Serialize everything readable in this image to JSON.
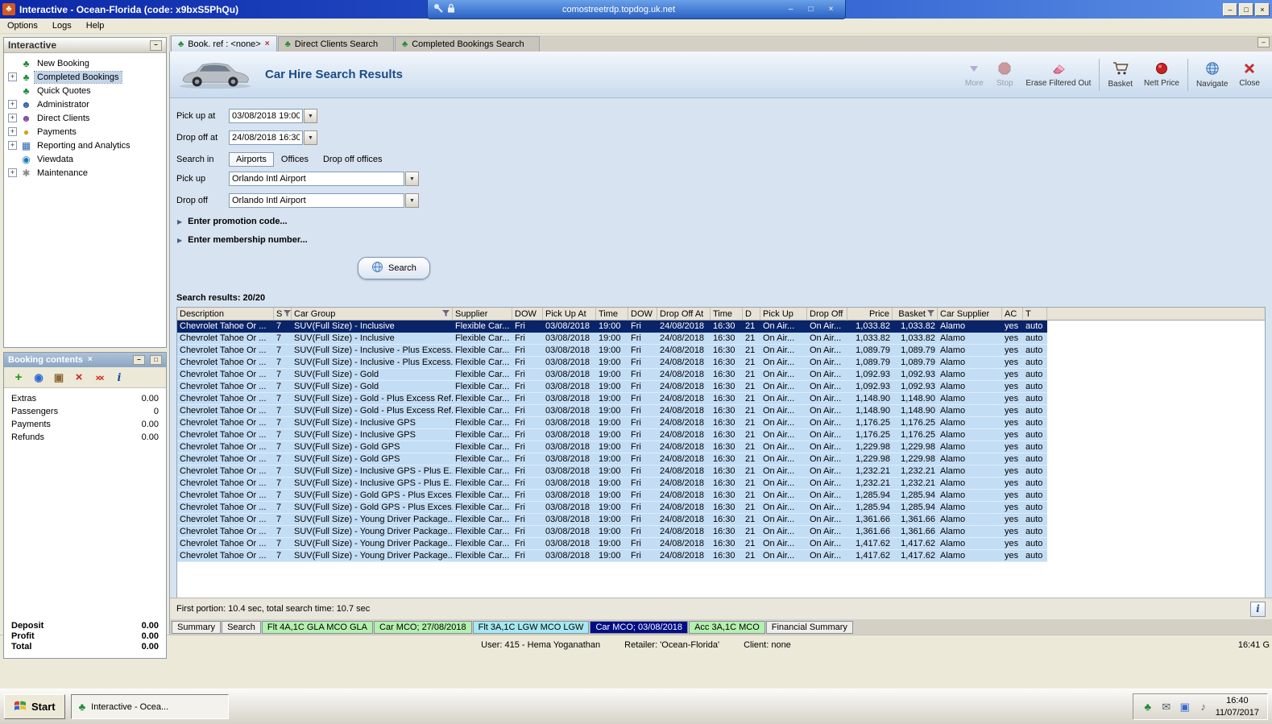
{
  "window": {
    "title": "Interactive - Ocean-Florida (code: x9bxS5PhQu)"
  },
  "rdp": {
    "host": "comostreetrdp.topdog.uk.net"
  },
  "glyphs": {
    "minimize": "–",
    "restore": "□",
    "close": "×",
    "dropdown": "▼",
    "plus": "+",
    "arrow": "▶",
    "info": "i",
    "palm": "♣"
  },
  "menu": {
    "items": [
      {
        "label": "Options"
      },
      {
        "label": "Logs"
      },
      {
        "label": "Help"
      }
    ]
  },
  "sidebar": {
    "title": "Interactive",
    "items": [
      {
        "label": "New Booking",
        "icon": "palm-tree-icon",
        "icon_cls": "palm",
        "expander": false,
        "cls": ""
      },
      {
        "label": "Completed Bookings",
        "icon": "palm-tree-icon",
        "icon_cls": "palm",
        "expander": true,
        "cls": "selected"
      },
      {
        "label": "Quick Quotes",
        "icon": "palm-tree-icon",
        "icon_cls": "palm",
        "expander": false,
        "cls": ""
      },
      {
        "label": "Administrator",
        "icon": "administrator-icon",
        "icon_cls": "admin",
        "expander": true,
        "cls": ""
      },
      {
        "label": "Direct Clients",
        "icon": "clients-icon",
        "icon_cls": "clients",
        "expander": true,
        "cls": ""
      },
      {
        "label": "Payments",
        "icon": "payments-icon",
        "icon_cls": "payments",
        "expander": true,
        "cls": ""
      },
      {
        "label": "Reporting and Analytics",
        "icon": "reporting-icon",
        "icon_cls": "reporting",
        "expander": true,
        "cls": ""
      },
      {
        "label": "Viewdata",
        "icon": "viewdata-icon",
        "icon_cls": "viewdata",
        "expander": false,
        "cls": ""
      },
      {
        "label": "Maintenance",
        "icon": "maintenance-icon",
        "icon_cls": "maintenance",
        "expander": true,
        "cls": ""
      }
    ]
  },
  "booking_contents": {
    "title": "Booking contents",
    "rows": [
      {
        "label": "Extras",
        "value": "0.00"
      },
      {
        "label": "Passengers",
        "value": "0"
      },
      {
        "label": "Payments",
        "value": "0.00"
      },
      {
        "label": "Refunds",
        "value": "0.00"
      }
    ],
    "totals": [
      {
        "label": "Deposit",
        "value": "0.00"
      },
      {
        "label": "Profit",
        "value": "0.00"
      },
      {
        "label": "Total",
        "value": "0.00"
      }
    ]
  },
  "tabs": [
    {
      "label": "Book. ref : <none>",
      "cls": "active",
      "closable": true
    },
    {
      "label": "Direct Clients Search",
      "cls": "",
      "closable": false
    },
    {
      "label": "Completed Bookings Search",
      "cls": "",
      "closable": false
    }
  ],
  "header": {
    "title": "Car Hire Search Results",
    "tools": [
      {
        "label": "More"
      },
      {
        "label": "Stop"
      },
      {
        "label": "Erase Filtered Out"
      },
      {
        "label": "Basket"
      },
      {
        "label": "Nett Price"
      },
      {
        "label": "Navigate"
      },
      {
        "label": "Close"
      }
    ]
  },
  "form": {
    "pickup_at_label": "Pick up at",
    "pickup_at_value": "03/08/2018 19:00",
    "dropoff_at_label": "Drop off at",
    "dropoff_at_value": "24/08/2018 16:30",
    "search_in_label": "Search in",
    "search_in_tabs": [
      {
        "label": "Airports",
        "cls": "selected"
      },
      {
        "label": "Offices",
        "cls": ""
      },
      {
        "label": "Drop off offices",
        "cls": ""
      }
    ],
    "pickup_label": "Pick up",
    "pickup_value": "Orlando Intl Airport",
    "dropoff_label": "Drop off",
    "dropoff_value": "Orlando Intl Airport",
    "promo_expander": "Enter promotion code...",
    "membership_expander": "Enter membership number...",
    "search_button": "Search"
  },
  "results": {
    "summary": "Search results: 20/20",
    "status": "First portion: 10.4 sec, total search time: 10.7 sec",
    "columns": [
      "Description",
      "S",
      "Car Group",
      "Supplier",
      "DOW",
      "Pick Up At",
      "Time",
      "DOW",
      "Drop Off At",
      "Time",
      "D",
      "Pick Up",
      "Drop Off",
      "Price",
      "Basket",
      "Car Supplier",
      "AC",
      "T"
    ],
    "rows": [
      {
        "desc": "Chevrolet Tahoe Or ...",
        "s": "7",
        "group": "SUV(Full Size) - Inclusive",
        "sup": "Flexible Car...",
        "dow1": "Fri",
        "pu_date": "03/08/2018",
        "pu_time": "19:00",
        "dow2": "Fri",
        "do_date": "24/08/2018",
        "do_time": "16:30",
        "d": "21",
        "pu_loc": "On Air...",
        "do_loc": "On Air...",
        "price": "1,033.82",
        "basket": "1,033.82",
        "car_sup": "Alamo",
        "ac": "yes",
        "t": "auto",
        "cls": "selected"
      },
      {
        "desc": "Chevrolet Tahoe Or ...",
        "s": "7",
        "group": "SUV(Full Size) - Inclusive",
        "sup": "Flexible Car...",
        "dow1": "Fri",
        "pu_date": "03/08/2018",
        "pu_time": "19:00",
        "dow2": "Fri",
        "do_date": "24/08/2018",
        "do_time": "16:30",
        "d": "21",
        "pu_loc": "On Air...",
        "do_loc": "On Air...",
        "price": "1,033.82",
        "basket": "1,033.82",
        "car_sup": "Alamo",
        "ac": "yes",
        "t": "auto",
        "cls": ""
      },
      {
        "desc": "Chevrolet Tahoe Or ...",
        "s": "7",
        "group": "SUV(Full Size) - Inclusive - Plus Excess...",
        "sup": "Flexible Car...",
        "dow1": "Fri",
        "pu_date": "03/08/2018",
        "pu_time": "19:00",
        "dow2": "Fri",
        "do_date": "24/08/2018",
        "do_time": "16:30",
        "d": "21",
        "pu_loc": "On Air...",
        "do_loc": "On Air...",
        "price": "1,089.79",
        "basket": "1,089.79",
        "car_sup": "Alamo",
        "ac": "yes",
        "t": "auto",
        "cls": ""
      },
      {
        "desc": "Chevrolet Tahoe Or ...",
        "s": "7",
        "group": "SUV(Full Size) - Inclusive - Plus Excess...",
        "sup": "Flexible Car...",
        "dow1": "Fri",
        "pu_date": "03/08/2018",
        "pu_time": "19:00",
        "dow2": "Fri",
        "do_date": "24/08/2018",
        "do_time": "16:30",
        "d": "21",
        "pu_loc": "On Air...",
        "do_loc": "On Air...",
        "price": "1,089.79",
        "basket": "1,089.79",
        "car_sup": "Alamo",
        "ac": "yes",
        "t": "auto",
        "cls": ""
      },
      {
        "desc": "Chevrolet Tahoe Or ...",
        "s": "7",
        "group": "SUV(Full Size) - Gold",
        "sup": "Flexible Car...",
        "dow1": "Fri",
        "pu_date": "03/08/2018",
        "pu_time": "19:00",
        "dow2": "Fri",
        "do_date": "24/08/2018",
        "do_time": "16:30",
        "d": "21",
        "pu_loc": "On Air...",
        "do_loc": "On Air...",
        "price": "1,092.93",
        "basket": "1,092.93",
        "car_sup": "Alamo",
        "ac": "yes",
        "t": "auto",
        "cls": ""
      },
      {
        "desc": "Chevrolet Tahoe Or ...",
        "s": "7",
        "group": "SUV(Full Size) - Gold",
        "sup": "Flexible Car...",
        "dow1": "Fri",
        "pu_date": "03/08/2018",
        "pu_time": "19:00",
        "dow2": "Fri",
        "do_date": "24/08/2018",
        "do_time": "16:30",
        "d": "21",
        "pu_loc": "On Air...",
        "do_loc": "On Air...",
        "price": "1,092.93",
        "basket": "1,092.93",
        "car_sup": "Alamo",
        "ac": "yes",
        "t": "auto",
        "cls": ""
      },
      {
        "desc": "Chevrolet Tahoe Or ...",
        "s": "7",
        "group": "SUV(Full Size) - Gold - Plus Excess Ref...",
        "sup": "Flexible Car...",
        "dow1": "Fri",
        "pu_date": "03/08/2018",
        "pu_time": "19:00",
        "dow2": "Fri",
        "do_date": "24/08/2018",
        "do_time": "16:30",
        "d": "21",
        "pu_loc": "On Air...",
        "do_loc": "On Air...",
        "price": "1,148.90",
        "basket": "1,148.90",
        "car_sup": "Alamo",
        "ac": "yes",
        "t": "auto",
        "cls": ""
      },
      {
        "desc": "Chevrolet Tahoe Or ...",
        "s": "7",
        "group": "SUV(Full Size) - Gold - Plus Excess Ref...",
        "sup": "Flexible Car...",
        "dow1": "Fri",
        "pu_date": "03/08/2018",
        "pu_time": "19:00",
        "dow2": "Fri",
        "do_date": "24/08/2018",
        "do_time": "16:30",
        "d": "21",
        "pu_loc": "On Air...",
        "do_loc": "On Air...",
        "price": "1,148.90",
        "basket": "1,148.90",
        "car_sup": "Alamo",
        "ac": "yes",
        "t": "auto",
        "cls": ""
      },
      {
        "desc": "Chevrolet Tahoe Or ...",
        "s": "7",
        "group": "SUV(Full Size) - Inclusive GPS",
        "sup": "Flexible Car...",
        "dow1": "Fri",
        "pu_date": "03/08/2018",
        "pu_time": "19:00",
        "dow2": "Fri",
        "do_date": "24/08/2018",
        "do_time": "16:30",
        "d": "21",
        "pu_loc": "On Air...",
        "do_loc": "On Air...",
        "price": "1,176.25",
        "basket": "1,176.25",
        "car_sup": "Alamo",
        "ac": "yes",
        "t": "auto",
        "cls": ""
      },
      {
        "desc": "Chevrolet Tahoe Or ...",
        "s": "7",
        "group": "SUV(Full Size) - Inclusive GPS",
        "sup": "Flexible Car...",
        "dow1": "Fri",
        "pu_date": "03/08/2018",
        "pu_time": "19:00",
        "dow2": "Fri",
        "do_date": "24/08/2018",
        "do_time": "16:30",
        "d": "21",
        "pu_loc": "On Air...",
        "do_loc": "On Air...",
        "price": "1,176.25",
        "basket": "1,176.25",
        "car_sup": "Alamo",
        "ac": "yes",
        "t": "auto",
        "cls": ""
      },
      {
        "desc": "Chevrolet Tahoe Or ...",
        "s": "7",
        "group": "SUV(Full Size) - Gold GPS",
        "sup": "Flexible Car...",
        "dow1": "Fri",
        "pu_date": "03/08/2018",
        "pu_time": "19:00",
        "dow2": "Fri",
        "do_date": "24/08/2018",
        "do_time": "16:30",
        "d": "21",
        "pu_loc": "On Air...",
        "do_loc": "On Air...",
        "price": "1,229.98",
        "basket": "1,229.98",
        "car_sup": "Alamo",
        "ac": "yes",
        "t": "auto",
        "cls": ""
      },
      {
        "desc": "Chevrolet Tahoe Or ...",
        "s": "7",
        "group": "SUV(Full Size) - Gold GPS",
        "sup": "Flexible Car...",
        "dow1": "Fri",
        "pu_date": "03/08/2018",
        "pu_time": "19:00",
        "dow2": "Fri",
        "do_date": "24/08/2018",
        "do_time": "16:30",
        "d": "21",
        "pu_loc": "On Air...",
        "do_loc": "On Air...",
        "price": "1,229.98",
        "basket": "1,229.98",
        "car_sup": "Alamo",
        "ac": "yes",
        "t": "auto",
        "cls": ""
      },
      {
        "desc": "Chevrolet Tahoe Or ...",
        "s": "7",
        "group": "SUV(Full Size) - Inclusive GPS - Plus E...",
        "sup": "Flexible Car...",
        "dow1": "Fri",
        "pu_date": "03/08/2018",
        "pu_time": "19:00",
        "dow2": "Fri",
        "do_date": "24/08/2018",
        "do_time": "16:30",
        "d": "21",
        "pu_loc": "On Air...",
        "do_loc": "On Air...",
        "price": "1,232.21",
        "basket": "1,232.21",
        "car_sup": "Alamo",
        "ac": "yes",
        "t": "auto",
        "cls": ""
      },
      {
        "desc": "Chevrolet Tahoe Or ...",
        "s": "7",
        "group": "SUV(Full Size) - Inclusive GPS - Plus E...",
        "sup": "Flexible Car...",
        "dow1": "Fri",
        "pu_date": "03/08/2018",
        "pu_time": "19:00",
        "dow2": "Fri",
        "do_date": "24/08/2018",
        "do_time": "16:30",
        "d": "21",
        "pu_loc": "On Air...",
        "do_loc": "On Air...",
        "price": "1,232.21",
        "basket": "1,232.21",
        "car_sup": "Alamo",
        "ac": "yes",
        "t": "auto",
        "cls": ""
      },
      {
        "desc": "Chevrolet Tahoe Or ...",
        "s": "7",
        "group": "SUV(Full Size) - Gold GPS - Plus Exces...",
        "sup": "Flexible Car...",
        "dow1": "Fri",
        "pu_date": "03/08/2018",
        "pu_time": "19:00",
        "dow2": "Fri",
        "do_date": "24/08/2018",
        "do_time": "16:30",
        "d": "21",
        "pu_loc": "On Air...",
        "do_loc": "On Air...",
        "price": "1,285.94",
        "basket": "1,285.94",
        "car_sup": "Alamo",
        "ac": "yes",
        "t": "auto",
        "cls": ""
      },
      {
        "desc": "Chevrolet Tahoe Or ...",
        "s": "7",
        "group": "SUV(Full Size) - Gold GPS - Plus Exces...",
        "sup": "Flexible Car...",
        "dow1": "Fri",
        "pu_date": "03/08/2018",
        "pu_time": "19:00",
        "dow2": "Fri",
        "do_date": "24/08/2018",
        "do_time": "16:30",
        "d": "21",
        "pu_loc": "On Air...",
        "do_loc": "On Air...",
        "price": "1,285.94",
        "basket": "1,285.94",
        "car_sup": "Alamo",
        "ac": "yes",
        "t": "auto",
        "cls": ""
      },
      {
        "desc": "Chevrolet Tahoe Or ...",
        "s": "7",
        "group": "SUV(Full Size) - Young Driver Package...",
        "sup": "Flexible Car...",
        "dow1": "Fri",
        "pu_date": "03/08/2018",
        "pu_time": "19:00",
        "dow2": "Fri",
        "do_date": "24/08/2018",
        "do_time": "16:30",
        "d": "21",
        "pu_loc": "On Air...",
        "do_loc": "On Air...",
        "price": "1,361.66",
        "basket": "1,361.66",
        "car_sup": "Alamo",
        "ac": "yes",
        "t": "auto",
        "cls": ""
      },
      {
        "desc": "Chevrolet Tahoe Or ...",
        "s": "7",
        "group": "SUV(Full Size) - Young Driver Package...",
        "sup": "Flexible Car...",
        "dow1": "Fri",
        "pu_date": "03/08/2018",
        "pu_time": "19:00",
        "dow2": "Fri",
        "do_date": "24/08/2018",
        "do_time": "16:30",
        "d": "21",
        "pu_loc": "On Air...",
        "do_loc": "On Air...",
        "price": "1,361.66",
        "basket": "1,361.66",
        "car_sup": "Alamo",
        "ac": "yes",
        "t": "auto",
        "cls": ""
      },
      {
        "desc": "Chevrolet Tahoe Or ...",
        "s": "7",
        "group": "SUV(Full Size) - Young Driver Package...",
        "sup": "Flexible Car...",
        "dow1": "Fri",
        "pu_date": "03/08/2018",
        "pu_time": "19:00",
        "dow2": "Fri",
        "do_date": "24/08/2018",
        "do_time": "16:30",
        "d": "21",
        "pu_loc": "On Air...",
        "do_loc": "On Air...",
        "price": "1,417.62",
        "basket": "1,417.62",
        "car_sup": "Alamo",
        "ac": "yes",
        "t": "auto",
        "cls": ""
      },
      {
        "desc": "Chevrolet Tahoe Or ...",
        "s": "7",
        "group": "SUV(Full Size) - Young Driver Package...",
        "sup": "Flexible Car...",
        "dow1": "Fri",
        "pu_date": "03/08/2018",
        "pu_time": "19:00",
        "dow2": "Fri",
        "do_date": "24/08/2018",
        "do_time": "16:30",
        "d": "21",
        "pu_loc": "On Air...",
        "do_loc": "On Air...",
        "price": "1,417.62",
        "basket": "1,417.62",
        "car_sup": "Alamo",
        "ac": "yes",
        "t": "auto",
        "cls": ""
      }
    ]
  },
  "bottom_tabs": [
    {
      "label": "Summary",
      "cls": ""
    },
    {
      "label": "Search",
      "cls": ""
    },
    {
      "label": "Flt 4A,1C GLA MCO GLA",
      "cls": "green"
    },
    {
      "label": "Car MCO; 27/08/2018",
      "cls": "green"
    },
    {
      "label": "Flt 3A,1C LGW MCO LGW",
      "cls": "cyan"
    },
    {
      "label": "Car MCO; 03/08/2018",
      "cls": "navy"
    },
    {
      "label": "Acc 3A,1C MCO",
      "cls": "green"
    },
    {
      "label": "Financial Summary",
      "cls": ""
    }
  ],
  "status_bar": {
    "user": "User: 415 - Hema Yoganathan",
    "retailer": "Retailer: 'Ocean-Florida'",
    "client": "Client: none",
    "time": "16:41 G"
  },
  "taskbar": {
    "start": "Start",
    "app": "Interactive - Ocea...",
    "clock_time": "16:40",
    "clock_date": "11/07/2017"
  }
}
